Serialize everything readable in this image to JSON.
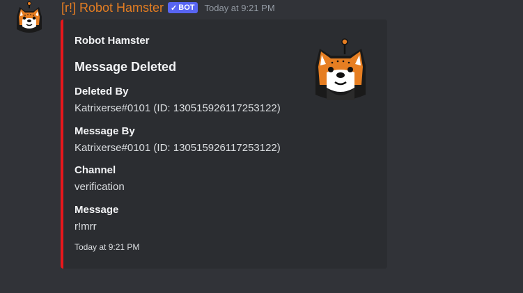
{
  "message": {
    "author": {
      "name": "[r!] Robot Hamster",
      "badge": "BOT",
      "badge_check": "✓",
      "name_color": "#e67e22",
      "avatar_icon": "hamster-avatar-icon"
    },
    "timestamp": "Today at 9:21 PM",
    "embed": {
      "accent_color": "#e8171b",
      "author": "Robot Hamster",
      "title": "Message Deleted",
      "thumbnail_icon": "hamster-thumbnail-icon",
      "fields": [
        {
          "name": "Deleted By",
          "value": "Katrixerse#0101 (ID: 130515926117253122)"
        },
        {
          "name": "Message By",
          "value": "Katrixerse#0101 (ID: 130515926117253122)"
        },
        {
          "name": "Channel",
          "value": "verification"
        },
        {
          "name": "Message",
          "value": "r!mrr"
        }
      ],
      "footer": "Today at 9:21 PM"
    }
  }
}
